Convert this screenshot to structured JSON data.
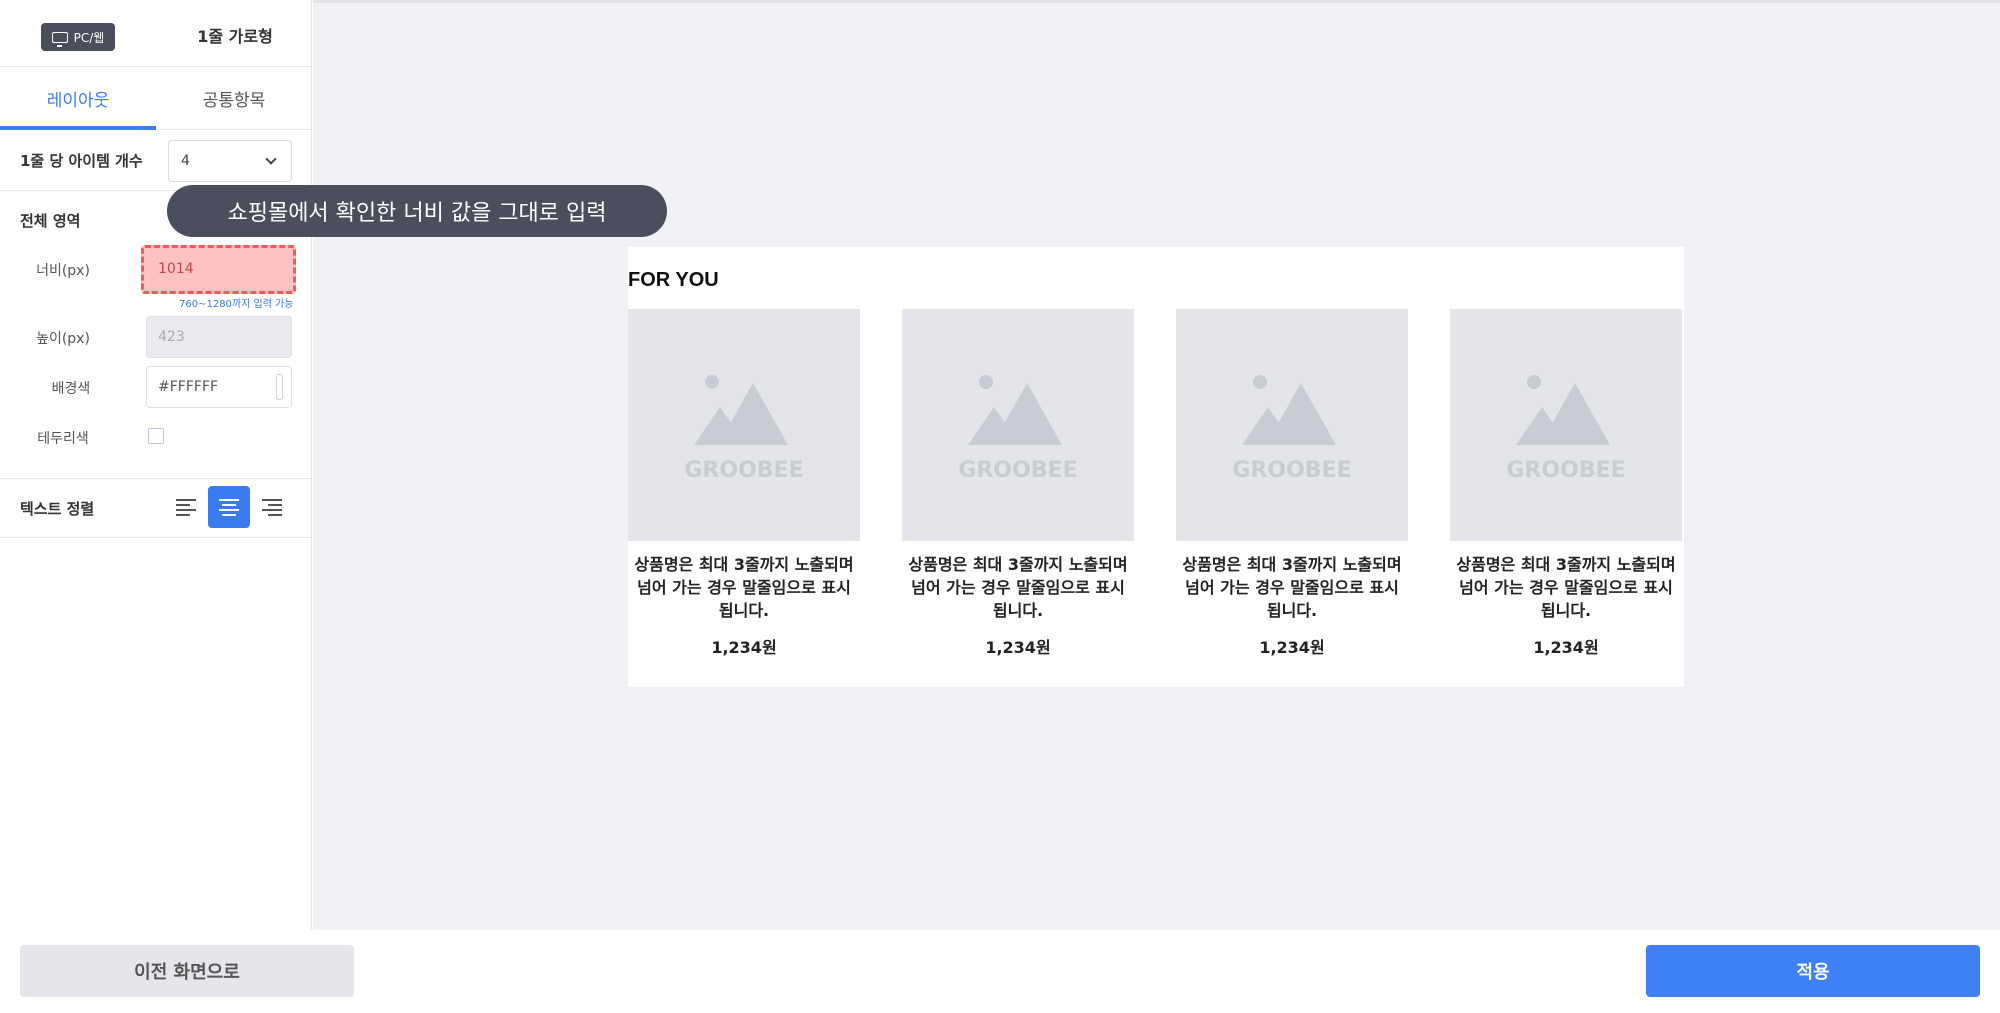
{
  "header": {
    "device_label": "PC/웹",
    "layout_type": "1줄 가로형"
  },
  "tabs": [
    {
      "label": "레이아웃",
      "active": true
    },
    {
      "label": "공통항목",
      "active": false
    }
  ],
  "items_per_row": {
    "label": "1줄 당 아이템 개수",
    "value": "4"
  },
  "area": {
    "title": "전체 영역",
    "width_label": "너비(px)",
    "width_value": "1014",
    "width_hint": "760~1280까지 입력 가능",
    "height_label": "높이(px)",
    "height_value": "423",
    "bg_label": "배경색",
    "bg_value": "#FFFFFF",
    "border_label": "테두리색"
  },
  "text_align": {
    "label": "텍스트 정렬",
    "selected": "center"
  },
  "tooltip": "쇼핑몰에서 확인한 너비 값을 그대로 입력",
  "preview": {
    "title": "FOR YOU",
    "logo_text": "GROOBEE",
    "products": [
      {
        "name": "상품명은 최대 3줄까지 노출되며 넘어 가는 경우 말줄임으로 표시됩니다.",
        "price": "1,234원"
      },
      {
        "name": "상품명은 최대 3줄까지 노출되며 넘어 가는 경우 말줄임으로 표시됩니다.",
        "price": "1,234원"
      },
      {
        "name": "상품명은 최대 3줄까지 노출되며 넘어 가는 경우 말줄임으로 표시됩니다.",
        "price": "1,234원"
      },
      {
        "name": "상품명은 최대 3줄까지 노출되며 넘어 가는 경우 말줄임으로 표시됩니다.",
        "price": "1,234원"
      }
    ]
  },
  "footer": {
    "back_label": "이전 화면으로",
    "apply_label": "적용"
  },
  "colors": {
    "accent": "#3F80F7",
    "badge_bg": "#4B4E5C",
    "highlight_fill": "#FFC2C2",
    "highlight_border": "#EF5A5A"
  }
}
